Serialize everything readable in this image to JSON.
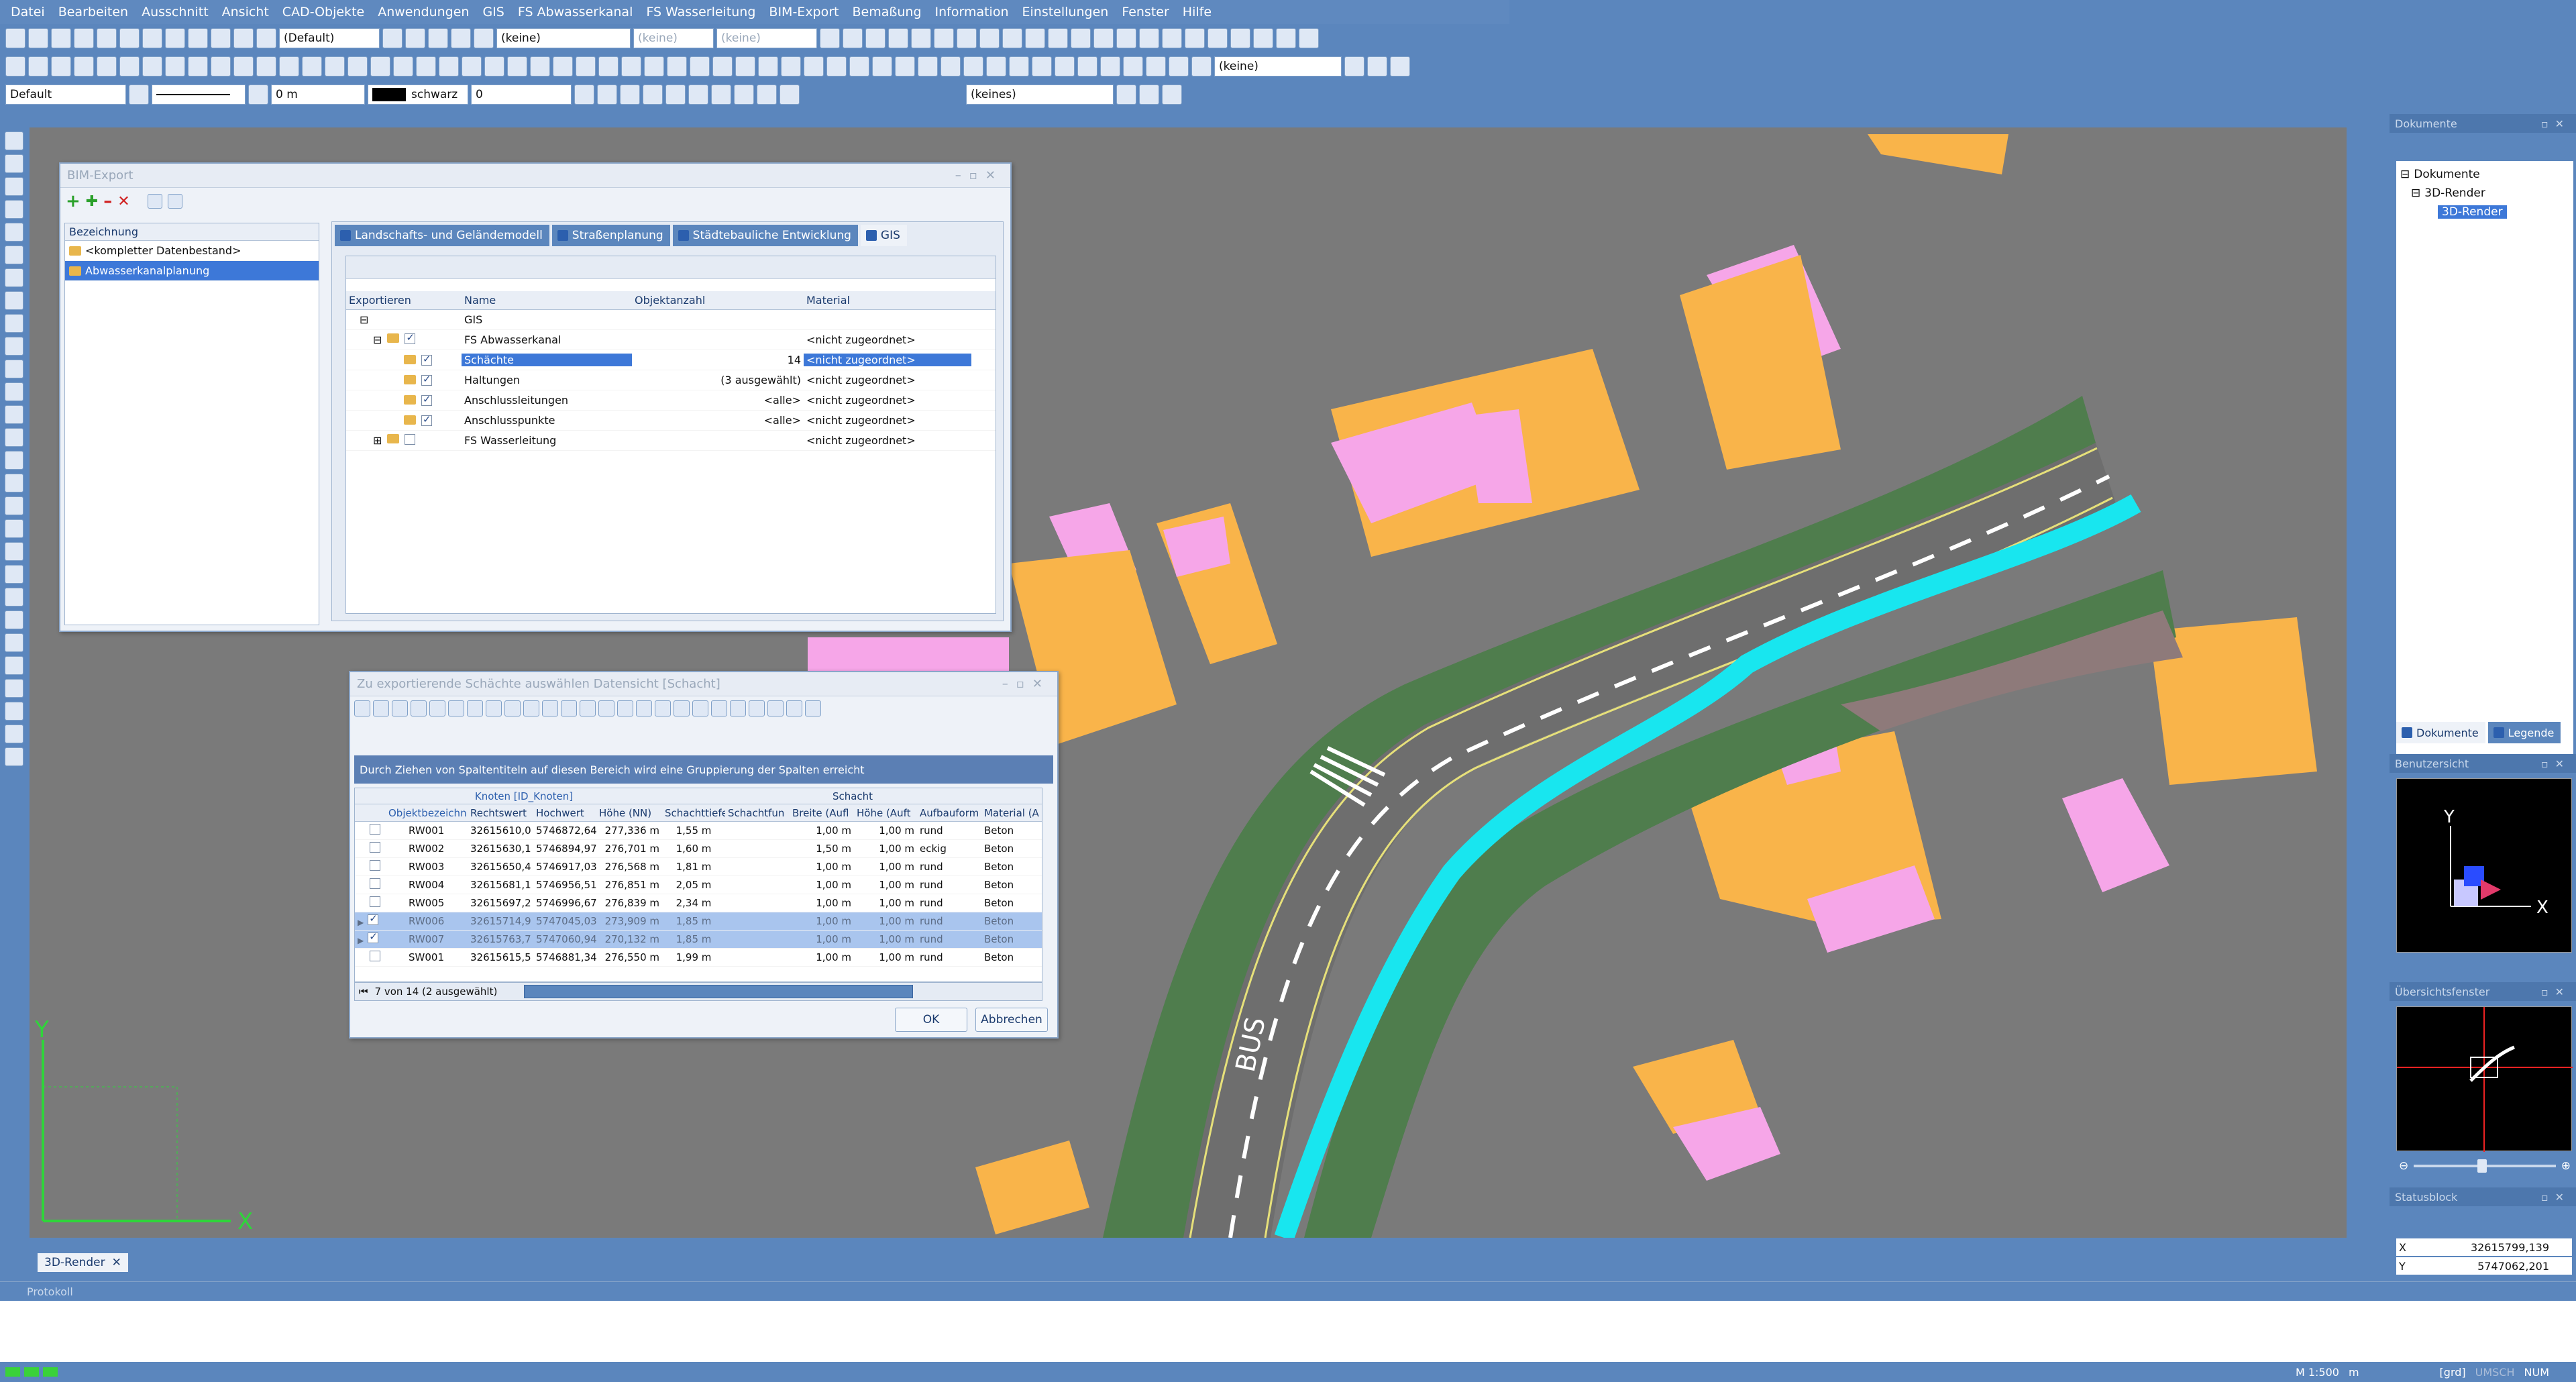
{
  "menu": [
    "Datei",
    "Bearbeiten",
    "Ausschnitt",
    "Ansicht",
    "CAD-Objekte",
    "Anwendungen",
    "GIS",
    "FS Abwasserkanal",
    "FS Wasserleitung",
    "BIM-Export",
    "Bemaßung",
    "Information",
    "Einstellungen",
    "Fenster",
    "Hilfe"
  ],
  "toolbar": {
    "combo_default": "(Default)",
    "combo_keine1": "(keine)",
    "combo_keine2": "(keine)",
    "combo_keine3": "(keine)",
    "combo_keine4": "(keine)",
    "layer": "Default",
    "distance": "0 m",
    "color": "schwarz",
    "zero": "0",
    "keines": "(keines)"
  },
  "colors": {
    "ui_blue": "#5b86bd",
    "canvas": "#7a7a7a",
    "building": "#f9b44a",
    "pink": "#f6a6e8",
    "green": "#4f7d4d",
    "cyan": "#18e6ef",
    "brown": "#8e7a7a"
  },
  "bim": {
    "title": "BIM-Export",
    "list_header": "Bezeichnung",
    "list_items": [
      "<kompletter Datenbestand>",
      "Abwasserkanalplanung"
    ],
    "tabs": [
      "Landschafts- und Geländemodell",
      "Straßenplanung",
      "Städtebauliche Entwicklung",
      "GIS"
    ],
    "cols": [
      "Exportieren",
      "Name",
      "Objektanzahl",
      "Material"
    ],
    "rows": [
      {
        "name": "GIS",
        "count": "",
        "mat": ""
      },
      {
        "name": "FS Abwasserkanal",
        "count": "",
        "mat": "<nicht zugeordnet>"
      },
      {
        "name": "Schächte",
        "count": "14",
        "mat": "<nicht zugeordnet>"
      },
      {
        "name": "Haltungen",
        "count": "(3 ausgewählt)",
        "mat": "<nicht zugeordnet>"
      },
      {
        "name": "Anschlussleitungen",
        "count": "<alle>",
        "mat": "<nicht zugeordnet>"
      },
      {
        "name": "Anschlusspunkte",
        "count": "<alle>",
        "mat": "<nicht zugeordnet>"
      },
      {
        "name": "FS Wasserleitung",
        "count": "",
        "mat": "<nicht zugeordnet>"
      }
    ]
  },
  "sel": {
    "title": "Zu exportierende Schächte auswählen Datensicht [Schacht]",
    "group_hint": "Durch Ziehen von Spaltentiteln auf diesen Bereich wird eine Gruppierung der Spalten erreicht",
    "band_knoten": "Knoten [ID_Knoten]",
    "band_schacht": "Schacht",
    "cols": [
      "Objektbezeichn",
      "Rechtswert",
      "Hochwert",
      "Höhe (NN)",
      "Schachttiefe",
      "Schachtfun",
      "Breite (Aufl",
      "Höhe (Auft",
      "Aufbauform",
      "Material (A"
    ],
    "rows": [
      [
        "RW001",
        "32615610,0",
        "5746872,64",
        "277,336 m",
        "1,55 m",
        "",
        "1,00 m",
        "1,00 m",
        "rund",
        "Beton"
      ],
      [
        "RW002",
        "32615630,1",
        "5746894,97",
        "276,701 m",
        "1,60 m",
        "",
        "1,50 m",
        "1,00 m",
        "eckig",
        "Beton"
      ],
      [
        "RW003",
        "32615650,4",
        "5746917,03",
        "276,568 m",
        "1,81 m",
        "",
        "1,00 m",
        "1,00 m",
        "rund",
        "Beton"
      ],
      [
        "RW004",
        "32615681,1",
        "5746956,51",
        "276,851 m",
        "2,05 m",
        "",
        "1,00 m",
        "1,00 m",
        "rund",
        "Beton"
      ],
      [
        "RW005",
        "32615697,2",
        "5746996,67",
        "276,839 m",
        "2,34 m",
        "",
        "1,00 m",
        "1,00 m",
        "rund",
        "Beton"
      ],
      [
        "RW006",
        "32615714,9",
        "5747045,03",
        "273,909 m",
        "1,85 m",
        "",
        "1,00 m",
        "1,00 m",
        "rund",
        "Beton"
      ],
      [
        "RW007",
        "32615763,7",
        "5747060,94",
        "270,132 m",
        "1,85 m",
        "",
        "1,00 m",
        "1,00 m",
        "rund",
        "Beton"
      ],
      [
        "SW001",
        "32615615,5",
        "5746881,34",
        "276,550 m",
        "1,99 m",
        "",
        "1,00 m",
        "1,00 m",
        "rund",
        "Beton"
      ]
    ],
    "status": "7 von 14 (2 ausgewählt)",
    "ok": "OK",
    "cancel": "Abbrechen"
  },
  "docs": {
    "title": "Dokumente",
    "root": "Dokumente",
    "child": "3D-Render",
    "leaf": "3D-Render",
    "tab1": "Dokumente",
    "tab2": "Legende"
  },
  "views": {
    "user": "Benutzersicht",
    "overview": "Übersichtsfenster",
    "status": "Statusblock",
    "axis_x": "X",
    "axis_y": "Y",
    "coord_x": "32615799,139",
    "coord_y": "5747062,201",
    "lbl_x": "X",
    "lbl_y": "Y"
  },
  "doc_tab": "3D-Render",
  "protokoll": "Protokoll",
  "statusbar": {
    "scale": "M 1:500",
    "unit": "m",
    "grd": "[grd]",
    "umsch": "UMSCH",
    "num": "NUM"
  },
  "canvas_axes": {
    "x": "X",
    "y": "Y"
  },
  "road_text": "BUS"
}
